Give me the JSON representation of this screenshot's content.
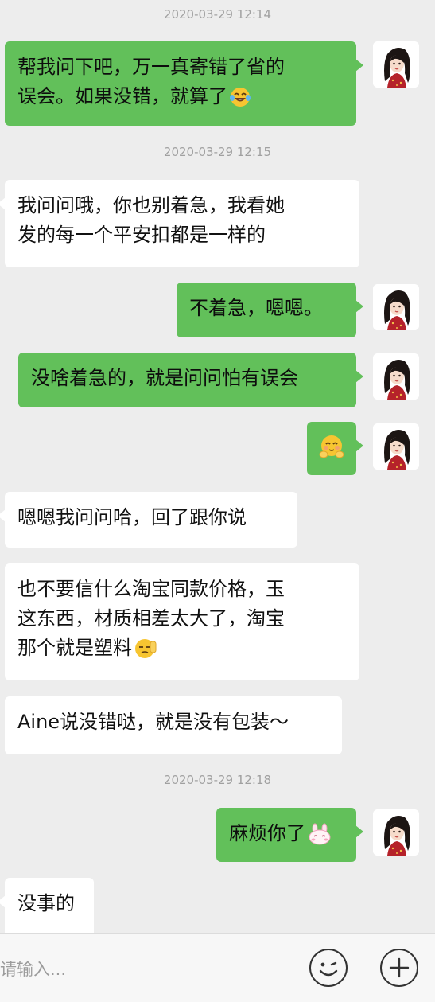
{
  "conversation": {
    "timestamps": [
      "2020-03-29 12:14",
      "2020-03-29 12:15",
      "2020-03-29 12:18"
    ],
    "messages": [
      {
        "sender": "me",
        "lines": [
          "帮我问下吧，万一真寄错了省的",
          "误会。如果没错，就算了"
        ],
        "emoji": "tears-of-joy-emoji"
      },
      {
        "sender": "them",
        "lines": [
          "我问问哦，你也别着急，我看她",
          "发的每一个平安扣都是一样的"
        ]
      },
      {
        "sender": "me",
        "lines": [
          "不着急，嗯嗯。"
        ]
      },
      {
        "sender": "me",
        "lines": [
          "没啥着急的，就是问问怕有误会"
        ]
      },
      {
        "sender": "me",
        "lines": [
          ""
        ],
        "emoji": "blushing-hands-emoji"
      },
      {
        "sender": "them",
        "lines": [
          "嗯嗯我问问哈，回了跟你说"
        ]
      },
      {
        "sender": "them",
        "lines": [
          "也不要信什么淘宝同款价格，玉",
          "这东西，材质相差太大了，淘宝",
          "那个就是塑料"
        ],
        "emoji": "salute-emoji"
      },
      {
        "sender": "them",
        "lines": [
          "Aine说没错哒，就是没有包装～"
        ]
      },
      {
        "sender": "me",
        "lines": [
          "麻烦你了"
        ],
        "emoji": "bunny-emoji"
      },
      {
        "sender": "them",
        "lines": [
          "没事的"
        ]
      }
    ]
  },
  "input_bar": {
    "placeholder": "请输入...",
    "emoji_button_icon": "smiley-icon",
    "add_button_icon": "plus-icon"
  },
  "colors": {
    "background": "#ededed",
    "my_bubble": "#62c05a",
    "their_bubble": "#ffffff",
    "timestamp": "#a0a0a0"
  }
}
